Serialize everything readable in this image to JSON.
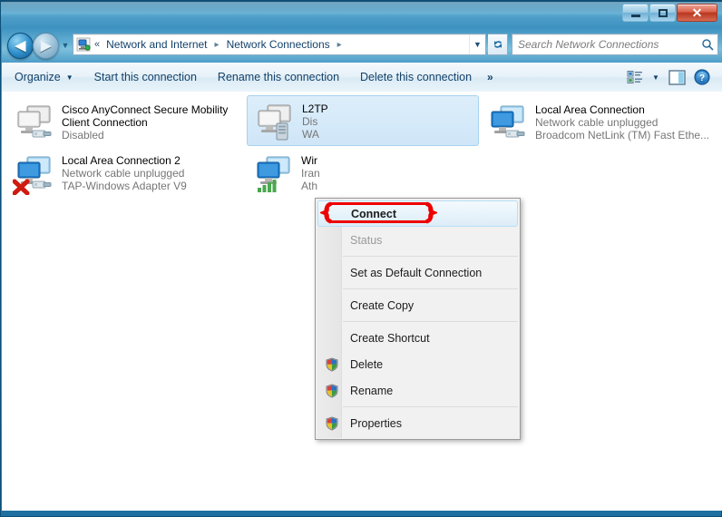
{
  "window": {
    "title": "",
    "buttons": {
      "minimize": "minimize",
      "maximize": "maximize",
      "close": "✕"
    }
  },
  "nav": {
    "back_label": "◀",
    "forward_label": "▶",
    "history_caret": "▼",
    "breadcrumb_chevron": "«",
    "breadcrumbs": [
      {
        "label": "Network and Internet",
        "separator": "▸"
      },
      {
        "label": "Network Connections",
        "separator": "▸"
      }
    ],
    "address_dropdown": "▼",
    "refresh_label": "↻"
  },
  "search": {
    "placeholder": "Search Network Connections",
    "value": "",
    "icon": "search-icon"
  },
  "toolbar": {
    "organize_label": "Organize",
    "organize_caret": "▼",
    "start_label": "Start this connection",
    "rename_label": "Rename this connection",
    "delete_label": "Delete this connection",
    "overflow_label": "»",
    "view_caret": "▼",
    "icons": {
      "views": "views-icon",
      "preview_pane": "preview-pane-icon",
      "help": "help-icon"
    }
  },
  "connections": [
    {
      "name": "Cisco AnyConnect Secure Mobility Client Connection",
      "status": "Disabled",
      "adapter": "",
      "icon": "network-adapter-disabled-icon",
      "selected": false,
      "column": 0,
      "row": 0,
      "truncated": false
    },
    {
      "name": "Local Area Connection 2",
      "status": "Network cable unplugged",
      "adapter": "TAP-Windows Adapter V9",
      "icon": "network-adapter-unplugged-icon",
      "selected": false,
      "column": 0,
      "row": 1,
      "truncated": false
    },
    {
      "name": "L2TP",
      "status": "Dis",
      "adapter": "WA",
      "icon": "vpn-connection-icon",
      "selected": true,
      "column": 1,
      "row": 0,
      "truncated": true
    },
    {
      "name": "Wir",
      "status": "Iran",
      "adapter": "Ath",
      "icon": "wireless-connection-icon",
      "selected": false,
      "column": 1,
      "row": 1,
      "truncated": true
    },
    {
      "name": "Local Area Connection",
      "status": "Network cable unplugged",
      "adapter": "Broadcom NetLink (TM) Fast Ethe...",
      "icon": "network-adapter-unplugged-icon",
      "selected": false,
      "column": 2,
      "row": 0,
      "truncated": false
    }
  ],
  "context_menu": {
    "items": [
      {
        "label": "Connect",
        "state": "highlighted",
        "shield": false,
        "separator_after": false
      },
      {
        "label": "Status",
        "state": "disabled",
        "shield": false,
        "separator_after": true
      },
      {
        "label": "Set as Default Connection",
        "state": "normal",
        "shield": false,
        "separator_after": true
      },
      {
        "label": "Create Copy",
        "state": "normal",
        "shield": false,
        "separator_after": true
      },
      {
        "label": "Create Shortcut",
        "state": "normal",
        "shield": false,
        "separator_after": false
      },
      {
        "label": "Delete",
        "state": "normal",
        "shield": true,
        "separator_after": false
      },
      {
        "label": "Rename",
        "state": "normal",
        "shield": true,
        "separator_after": true
      },
      {
        "label": "Properties",
        "state": "normal",
        "shield": true,
        "separator_after": false
      }
    ]
  },
  "annotation": {
    "shape": "red-rounded-rect-with-braces",
    "color": "#ee0000",
    "target": "Connect"
  },
  "colors": {
    "accent": "#2d86b8",
    "frame": "#0d4f78",
    "selection": "#cfe6f8",
    "annotation_red": "#ee0000",
    "muted_text": "#767676"
  }
}
